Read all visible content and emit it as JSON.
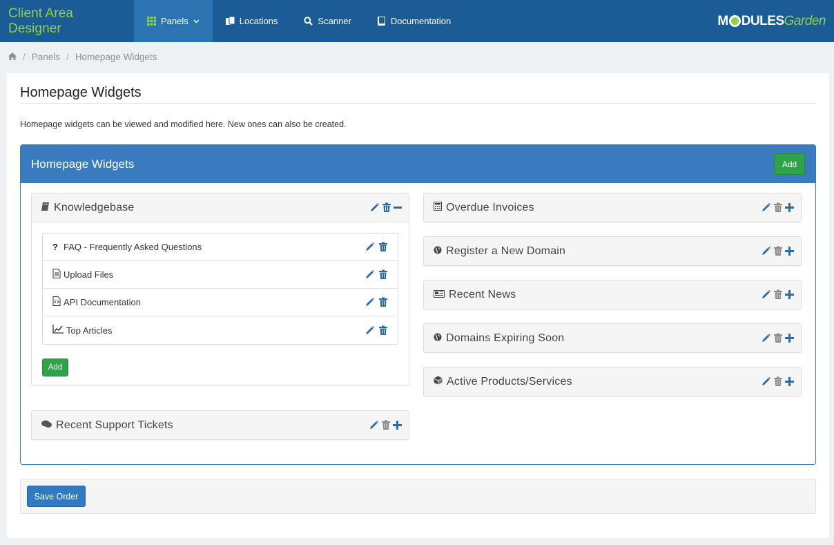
{
  "navbar": {
    "brand": "Client Area Designer",
    "items": [
      {
        "label": "Panels",
        "icon": "grid-icon",
        "active": true,
        "dropdown": true
      },
      {
        "label": "Locations",
        "icon": "files-icon"
      },
      {
        "label": "Scanner",
        "icon": "search-icon"
      },
      {
        "label": "Documentation",
        "icon": "book-icon"
      }
    ],
    "logo": {
      "part1": "M",
      "part2": "DULES",
      "part3": "Garden"
    }
  },
  "breadcrumb": {
    "home_icon": "home-icon",
    "items": [
      "Panels",
      "Homepage Widgets"
    ]
  },
  "page": {
    "title": "Homepage Widgets",
    "description": "Homepage widgets can be viewed and modified here. New ones can also be created."
  },
  "panel": {
    "title": "Homepage Widgets",
    "add_label": "Add",
    "left_widgets": [
      {
        "title": "Knowledgebase",
        "icon": "book-icon",
        "expanded": true,
        "items": [
          {
            "label": "FAQ - Frequently Asked Questions",
            "icon": "question-icon"
          },
          {
            "label": "Upload Files",
            "icon": "file-icon"
          },
          {
            "label": "API Documentation",
            "icon": "code-file-icon"
          },
          {
            "label": "Top Articles",
            "icon": "line-chart-icon"
          }
        ],
        "add_label": "Add"
      },
      {
        "title": "Recent Support Tickets",
        "icon": "comments-icon",
        "expanded": false
      }
    ],
    "right_widgets": [
      {
        "title": "Overdue Invoices",
        "icon": "calculator-icon"
      },
      {
        "title": "Register a New Domain",
        "icon": "globe-icon"
      },
      {
        "title": "Recent News",
        "icon": "newspaper-icon"
      },
      {
        "title": "Domains Expiring Soon",
        "icon": "globe-icon"
      },
      {
        "title": "Active Products/Services",
        "icon": "cube-icon"
      }
    ]
  },
  "footer": {
    "save_label": "Save Order"
  },
  "colors": {
    "navbar": "#1b5b96",
    "navbar_active": "#2c73b2",
    "brand": "#8ed14a",
    "panel_header": "#3a7bbf",
    "add_button": "#2ea34a",
    "action_blue": "#2c6aa3"
  }
}
